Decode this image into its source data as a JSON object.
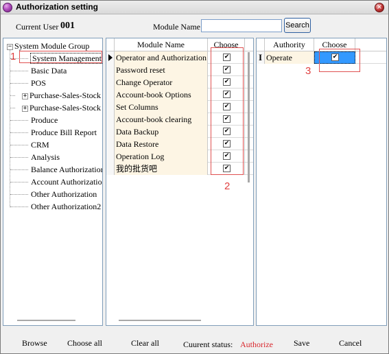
{
  "window": {
    "title": "Authorization setting",
    "close_icon": "×"
  },
  "topbar": {
    "current_user_label": "Current User",
    "current_user_value": "001",
    "module_name_label": "Module Name:",
    "module_name_value": "",
    "search_label": "Search"
  },
  "tree": {
    "root": "System Module Group",
    "items": [
      {
        "label": "System Management",
        "expandable": false,
        "selected": true
      },
      {
        "label": "Basic Data",
        "expandable": false
      },
      {
        "label": "POS",
        "expandable": false
      },
      {
        "label": "Purchase-Sales-Stock",
        "expandable": true
      },
      {
        "label": "Purchase-Sales-Stock",
        "expandable": true
      },
      {
        "label": "Produce",
        "expandable": false
      },
      {
        "label": "Produce Bill Report",
        "expandable": false
      },
      {
        "label": "CRM",
        "expandable": false
      },
      {
        "label": "Analysis",
        "expandable": false
      },
      {
        "label": "Balance Authorization",
        "expandable": false
      },
      {
        "label": "Account Authorization",
        "expandable": false
      },
      {
        "label": "Other Authorization",
        "expandable": false
      },
      {
        "label": "Other Authorization2",
        "expandable": false
      }
    ]
  },
  "module_grid": {
    "headers": {
      "name": "Module Name",
      "choose": "Choose"
    },
    "rows": [
      {
        "name": "Operator and Authorization",
        "checked": true
      },
      {
        "name": "Password reset",
        "checked": true
      },
      {
        "name": "Change Operator",
        "checked": true
      },
      {
        "name": "Account-book Options",
        "checked": true
      },
      {
        "name": "Set Columns",
        "checked": true
      },
      {
        "name": "Account-book clearing",
        "checked": true
      },
      {
        "name": "Data Backup",
        "checked": true
      },
      {
        "name": "Data Restore",
        "checked": true
      },
      {
        "name": "Operation Log",
        "checked": true
      },
      {
        "name": "我的批货吧",
        "checked": true
      }
    ]
  },
  "authority_grid": {
    "headers": {
      "authority": "Authority",
      "choose": "Choose"
    },
    "rows": [
      {
        "authority": "Operate",
        "checked": true
      }
    ]
  },
  "annotations": [
    "1",
    "2",
    "3"
  ],
  "bottom": {
    "browse": "Browse",
    "choose_all": "Choose all",
    "clear_all": "Clear all",
    "status_label": "Cuurent status:",
    "status_value": "Authorize",
    "save": "Save",
    "cancel": "Cancel"
  },
  "colors": {
    "status": "#d9262c",
    "annotation": "#e05050",
    "selection": "#3399ff",
    "cell_bg": "#fdf5e4"
  }
}
